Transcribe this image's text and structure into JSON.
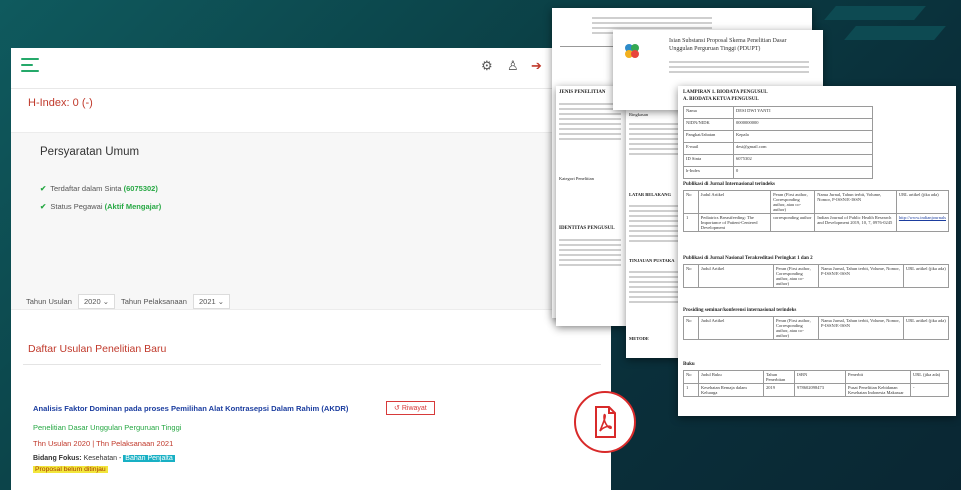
{
  "page": {
    "hindex_label": "H-Index:",
    "hindex_value": "0 (-)"
  },
  "requirements": {
    "title": "Persyaratan Umum",
    "items": [
      {
        "label": "Terdaftar dalam Sinta",
        "value": "(6075302)"
      },
      {
        "label": "Status Pegawai",
        "value": "(Aktif Mengajar)"
      }
    ]
  },
  "filter": {
    "tahun_usulan_label": "Tahun Usulan",
    "tahun_usulan_value": "2020",
    "tahun_pelaksanaan_label": "Tahun Pelaksanaan",
    "tahun_pelaksanaan_value": "2021"
  },
  "daftar": {
    "title": "Daftar Usulan Penelitian Baru",
    "proposal": {
      "title": "Analisis Faktor Dominan pada proses Pemilihan Alat Kontrasepsi Dalam Rahim (AKDR)",
      "riwayat_label": "Riwayat",
      "skema": "Penelitian Dasar Unggulan Perguruan Tinggi",
      "tahun": "Thn Usulan 2020 | Thn Pelaksanaan 2021",
      "bidang_label": "Bidang Fokus:",
      "bidang_value": "Kesehatan -",
      "bidang_highlight": "Bahan Penjalta",
      "status": "Proposal belum ditinjau"
    }
  },
  "docs": {
    "doc2_title_1": "Isian Substansi Proposal Skema Penelitian Dasar",
    "doc2_title_2": "Unggulan Perguruan Tinggi (PDUPT)",
    "doc3_header_1": "LAMPIRAN 1. BIODATA PENGUSUL",
    "doc3_header_2": "A. BIODATA KETUA PENGUSUL",
    "doc3_rows": [
      {
        "k": "Nama",
        "v": "DESI DWI YANTI"
      },
      {
        "k": "NIDN/NIDK",
        "v": "0000000000"
      },
      {
        "k": "Pangkat/Jabatan",
        "v": "Kepala"
      },
      {
        "k": "E-mail",
        "v": "desi@gmail.com"
      },
      {
        "k": "ID Sinta",
        "v": "6075302"
      },
      {
        "k": "h-Index",
        "v": "0"
      }
    ],
    "sec_b": "Publikasi di Jurnal Internasional terindeks",
    "sec_c": "Publikasi di Jurnal Nasional Terakreditasi Peringkat 1 dan 2",
    "sec_d": "Prosiding seminar/konferensi internasional terindeks",
    "sec_e": "Buku",
    "col_no": "No",
    "col_judul": "Judul Artikel",
    "col_peran": "Peran (First author, Corresponding author, atau co-author)",
    "col_jurnal": "Nama Jurnal, Tahun terbit, Volume, Nomor, P-ISSN/E-ISSN",
    "col_url": "URL artikel (jika ada)",
    "pub_row": {
      "no": "1",
      "judul": "Pediatrics Breastfeeding: The Importance of Patient-Centered Development",
      "peran": "corresponding author",
      "jurnal": "Indian Journal of Public Health Research and Development 2019, 10, 7, 0976-0245",
      "url": "http://www.indianjournals"
    },
    "book_cols": [
      "No",
      "Judul Buku",
      "Tahun Penerbitan",
      "ISBN",
      "Penerbit",
      "URL (jika ada)"
    ],
    "book_row": {
      "no": "1",
      "judul": "Kesehatan Remaja dalam Keluarga",
      "tahun": "2019",
      "isbn": "978602098473",
      "penerbit": "Pusat Penelitian Kebidanan Kesehatan Indonesia Makassar",
      "url": "-"
    },
    "doc4_jenis": "JENIS PENELITIAN",
    "doc4_identitas": "Kategori Penelitian",
    "doc4_ringkasan": "Ringkasan",
    "doc4_latar": "LATAR BELAKANG",
    "doc4_tinjauan": "TINJAUAN PUSTAKA",
    "doc4_metode": "METODE",
    "doc4_identitas_pengusul": "IDENTITAS PENGUSUL"
  },
  "colors": {
    "accent_green": "#27a844",
    "accent_red": "#c0392b",
    "link_blue": "#1b3d9f",
    "highlight": "#f2e63c"
  },
  "icons": [
    "menu-icon",
    "settings-icon",
    "user-icon",
    "logout-icon",
    "chevron-down-icon",
    "check-icon",
    "history-icon",
    "pdf-icon",
    "logo-icon"
  ]
}
